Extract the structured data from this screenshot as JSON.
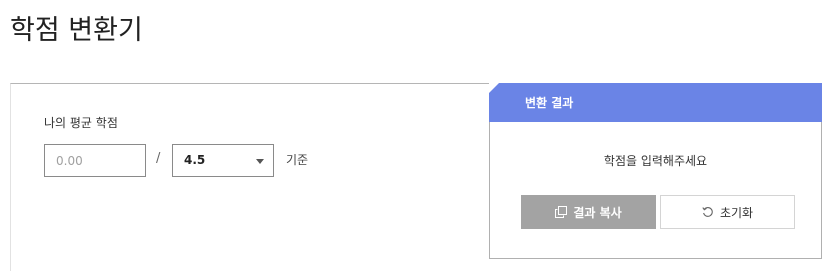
{
  "page": {
    "title": "학점 변환기"
  },
  "form": {
    "label": "나의 평균 학점",
    "gpa_placeholder": "0.00",
    "gpa_value": "",
    "separator": "/",
    "scale_selected": "4.5",
    "basis_label": "기준"
  },
  "result": {
    "header": "변환 결과",
    "message": "학점을 입력해주세요",
    "copy_label": "결과 복사",
    "reset_label": "초기화"
  },
  "colors": {
    "header_bg": "#6a84e6",
    "copy_button_bg": "#a3a3a3"
  },
  "icons": {
    "copy": "copy-icon",
    "reset": "reset-icon",
    "dropdown": "chevron-down-icon"
  }
}
